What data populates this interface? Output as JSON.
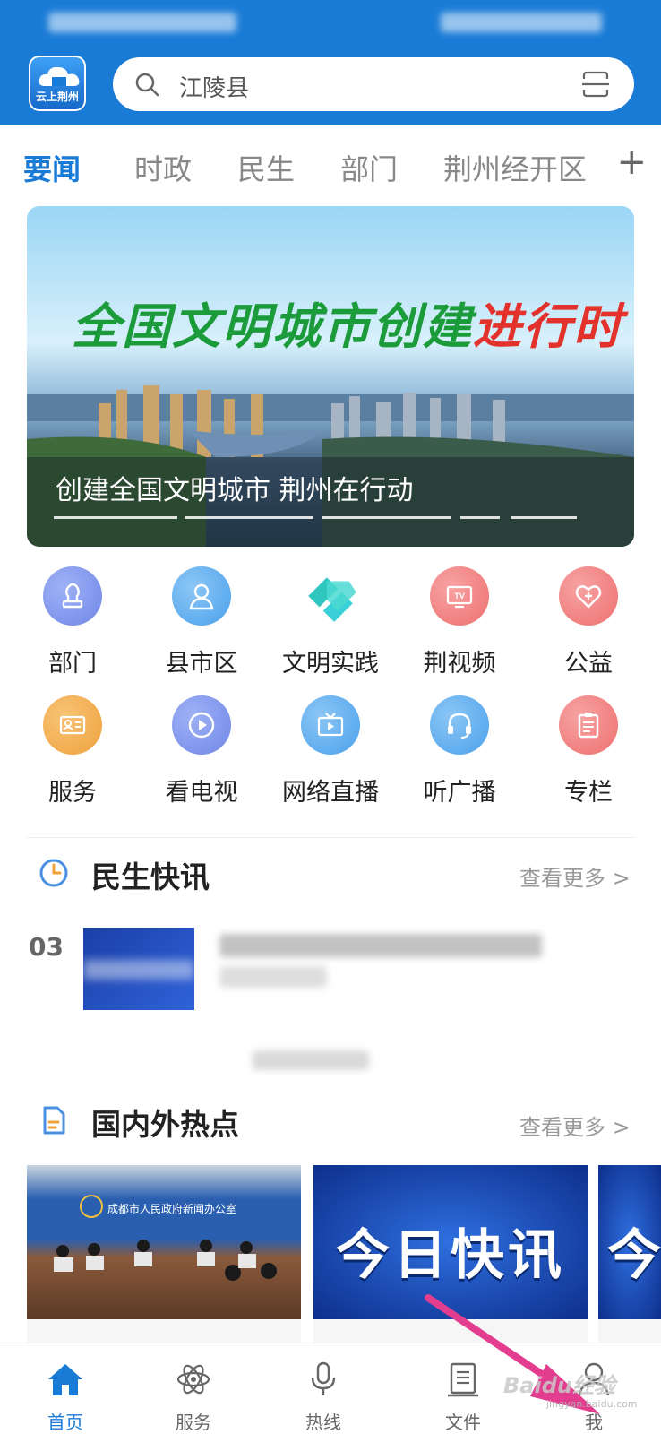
{
  "header": {
    "logo_text": "云上荆州",
    "search_text": "江陵县",
    "color": "#1a7bd6"
  },
  "tabs": [
    {
      "label": "要闻",
      "active": true
    },
    {
      "label": "时政",
      "active": false
    },
    {
      "label": "民生",
      "active": false
    },
    {
      "label": "部门",
      "active": false
    },
    {
      "label": "荆州经开区",
      "active": false
    }
  ],
  "tab_add": "+",
  "banner": {
    "slogan_green": "全国文明城市创建",
    "slogan_red": "进行时",
    "caption": "创建全国文明城市 荆州在行动"
  },
  "grid": [
    {
      "label": "部门",
      "icon": "stamp-icon",
      "color": "#6f86e8"
    },
    {
      "label": "县市区",
      "icon": "person-icon",
      "color": "#4aa1ec"
    },
    {
      "label": "文明实践",
      "icon": "handshake-icon",
      "color": "#2fc6c0"
    },
    {
      "label": "荆视频",
      "icon": "tv-icon",
      "color": "#ef6f6f"
    },
    {
      "label": "公益",
      "icon": "heart-icon",
      "color": "#ef6f6f"
    },
    {
      "label": "服务",
      "icon": "id-card-icon",
      "color": "#f0a23c"
    },
    {
      "label": "看电视",
      "icon": "play-icon",
      "color": "#6f86e8"
    },
    {
      "label": "网络直播",
      "icon": "live-tv-icon",
      "color": "#4aa1ec"
    },
    {
      "label": "听广播",
      "icon": "headset-icon",
      "color": "#4aa1ec"
    },
    {
      "label": "专栏",
      "icon": "clipboard-icon",
      "color": "#ef6f6f"
    }
  ],
  "sections": {
    "minsheng": {
      "title": "民生快讯",
      "more": "查看更多 >"
    },
    "hot": {
      "title": "国内外热点",
      "more": "查看更多 >"
    }
  },
  "news": [
    {
      "rank": "03"
    }
  ],
  "hot_cards": [
    {
      "text": "成都市人民政府新闻办公室"
    },
    {
      "text": "今日快讯"
    },
    {
      "text": "今"
    }
  ],
  "bottom_nav": [
    {
      "label": "首页",
      "icon": "home-icon",
      "active": true
    },
    {
      "label": "服务",
      "icon": "atom-icon",
      "active": false
    },
    {
      "label": "热线",
      "icon": "microphone-icon",
      "active": false
    },
    {
      "label": "文件",
      "icon": "document-icon",
      "active": false
    },
    {
      "label": "我",
      "icon": "user-icon",
      "active": false
    }
  ],
  "watermark": {
    "main": "Baidu经验",
    "sub": "jingyan.baidu.com"
  }
}
